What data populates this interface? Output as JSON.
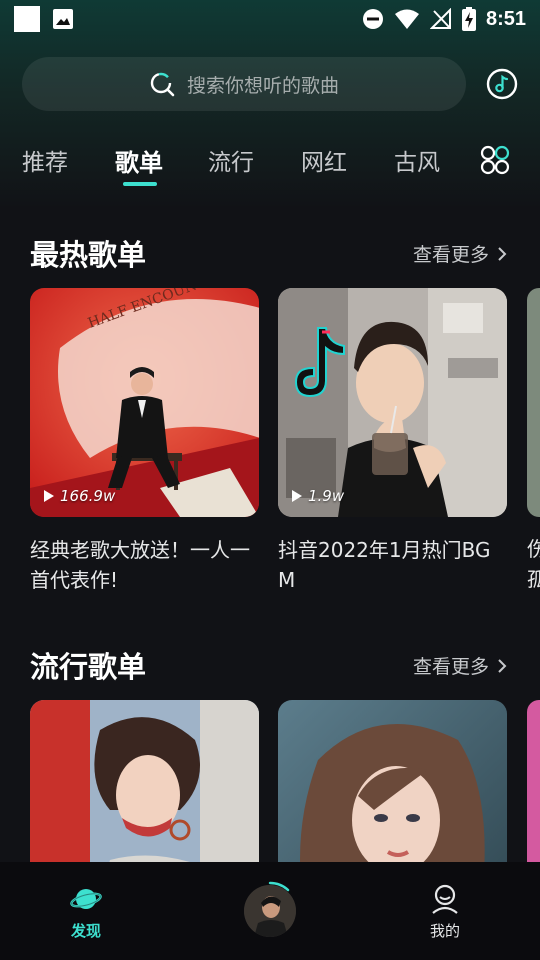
{
  "status_bar": {
    "time": "8:51",
    "icons": [
      "notification-square-icon",
      "image-icon",
      "do-not-disturb-icon",
      "wifi-icon",
      "no-signal-icon",
      "battery-charging-icon"
    ]
  },
  "search": {
    "placeholder": "搜索你想听的歌曲",
    "icon": "search-icon",
    "right_icon": "music-note-icon"
  },
  "tabs": [
    {
      "label": "推荐",
      "active": false
    },
    {
      "label": "歌单",
      "active": true
    },
    {
      "label": "流行",
      "active": false
    },
    {
      "label": "网红",
      "active": false
    },
    {
      "label": "古风",
      "active": false
    }
  ],
  "tabs_more_icon": "grid-icon",
  "colors": {
    "accent": "#3de0cf",
    "background": "#111216",
    "header_gradient_top": "#0f3a35"
  },
  "sections": [
    {
      "title": "最热歌单",
      "more_label": "查看更多",
      "cards": [
        {
          "play_count": "166.9w",
          "title": "经典老歌大放送！一人一首代表作!"
        },
        {
          "play_count": "1.9w",
          "title": "抖音2022年1月热门BGM"
        }
      ],
      "peek_text": "伤孤"
    },
    {
      "title": "流行歌单",
      "more_label": "查看更多",
      "cards": [
        {
          "play_count": "",
          "title": ""
        },
        {
          "play_count": "",
          "title": ""
        }
      ]
    }
  ],
  "bottom_nav": {
    "discover": {
      "label": "发现",
      "icon": "planet-icon",
      "active": true
    },
    "player": {
      "icon": "now-playing-disc"
    },
    "mine": {
      "label": "我的",
      "icon": "user-icon",
      "active": false
    }
  }
}
